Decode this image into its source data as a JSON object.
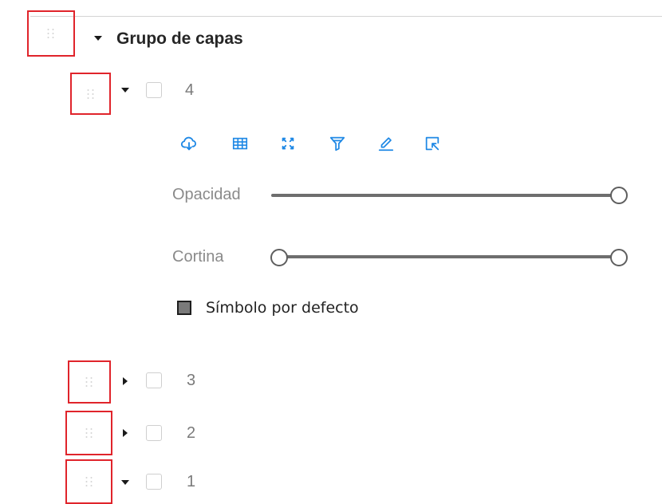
{
  "group": {
    "label": "Grupo de capas"
  },
  "layers": [
    {
      "label": "4",
      "expanded": true
    },
    {
      "label": "3",
      "expanded": false
    },
    {
      "label": "2",
      "expanded": false
    },
    {
      "label": "1",
      "expanded": true
    }
  ],
  "tools": [
    "cloud-download-icon",
    "table-icon",
    "zoom-to-extent-icon",
    "filter-icon",
    "edit-icon",
    "select-icon"
  ],
  "opacity": {
    "label": "Opacidad",
    "value": 1.0
  },
  "curtain": {
    "label": "Cortina",
    "range": [
      0.0,
      1.0
    ]
  },
  "symbol": {
    "label": "Símbolo por defecto",
    "color": "#7a7a7a"
  },
  "colors": {
    "accent": "#1e88e5",
    "handle_border": "#e0242b"
  }
}
